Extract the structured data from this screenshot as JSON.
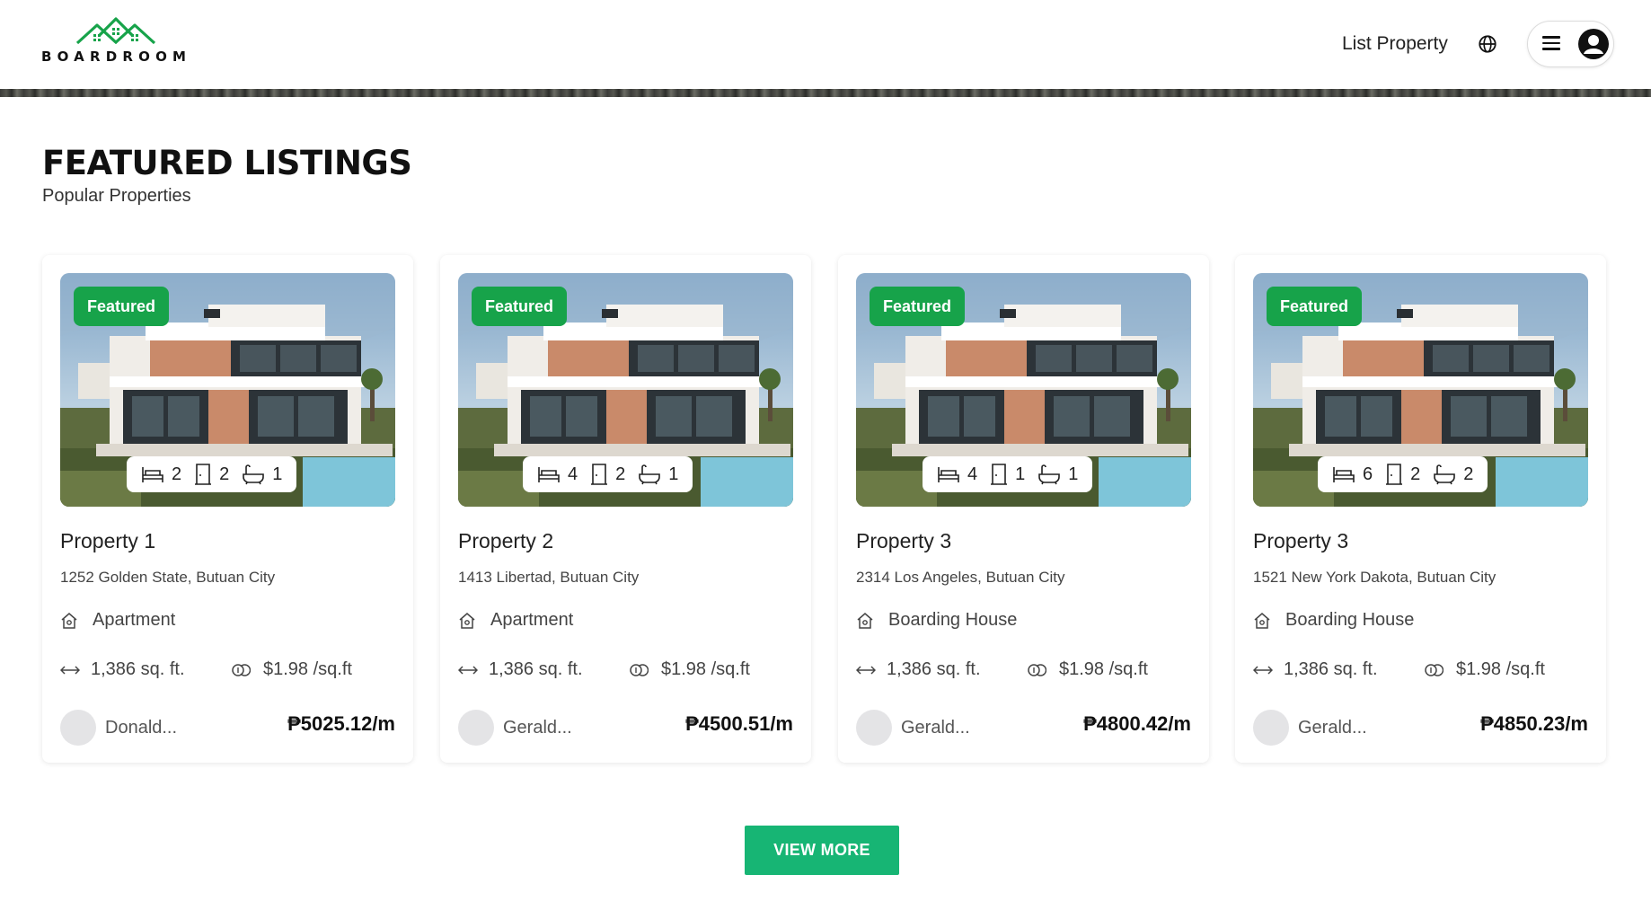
{
  "header": {
    "logo_text": "BOARDROOM",
    "list_property": "List Property",
    "icons": {
      "globe": "globe-icon",
      "menu": "hamburger-menu-icon",
      "account": "user-avatar-icon"
    }
  },
  "section": {
    "title": "FEATURED LISTINGS",
    "subtitle": "Popular Properties"
  },
  "listings": [
    {
      "badge": "Featured",
      "beds": "2",
      "doors": "2",
      "baths": "1",
      "title": "Property 1",
      "address": "1252 Golden State, Butuan City",
      "type": "Apartment",
      "area": "1,386 sq. ft.",
      "price_sqft": "$1.98 /sq.ft",
      "owner": "Donald...",
      "rent": "₱5025.12/m"
    },
    {
      "badge": "Featured",
      "beds": "4",
      "doors": "2",
      "baths": "1",
      "title": "Property 2",
      "address": "1413 Libertad, Butuan City",
      "type": "Apartment",
      "area": "1,386 sq. ft.",
      "price_sqft": "$1.98 /sq.ft",
      "owner": "Gerald...",
      "rent": "₱4500.51/m"
    },
    {
      "badge": "Featured",
      "beds": "4",
      "doors": "1",
      "baths": "1",
      "title": "Property 3",
      "address": "2314 Los Angeles, Butuan City",
      "type": "Boarding House",
      "area": "1,386 sq. ft.",
      "price_sqft": "$1.98 /sq.ft",
      "owner": "Gerald...",
      "rent": "₱4800.42/m"
    },
    {
      "badge": "Featured",
      "beds": "6",
      "doors": "2",
      "baths": "2",
      "title": "Property 3",
      "address": "1521 New York Dakota, Butuan City",
      "type": "Boarding House",
      "area": "1,386 sq. ft.",
      "price_sqft": "$1.98 /sq.ft",
      "owner": "Gerald...",
      "rent": "₱4850.23/m"
    }
  ],
  "view_more": "VIEW MORE",
  "colors": {
    "brand_green": "#17a34a",
    "button_green": "#17b574"
  }
}
